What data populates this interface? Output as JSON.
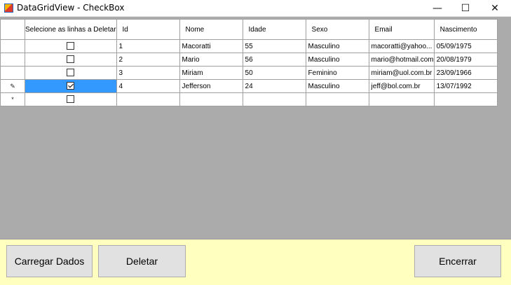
{
  "window": {
    "title": "DataGridView - CheckBox",
    "controls": {
      "minimize": "—",
      "maximize": "☐",
      "close": "✕"
    }
  },
  "grid": {
    "columns": [
      "Selecione as linhas a Deletar",
      "Id",
      "Nome",
      "Idade",
      "Sexo",
      "Email",
      "Nascimento"
    ],
    "rows": [
      {
        "checked": false,
        "id": "1",
        "nome": "Macoratti",
        "idade": "55",
        "sexo": "Masculino",
        "email": "macoratti@yahoo...",
        "nascimento": "05/09/1975",
        "indicator": ""
      },
      {
        "checked": false,
        "id": "2",
        "nome": "Mario",
        "idade": "56",
        "sexo": "Masculino",
        "email": "mario@hotmail.com",
        "nascimento": "20/08/1979",
        "indicator": ""
      },
      {
        "checked": false,
        "id": "3",
        "nome": "Miriam",
        "idade": "50",
        "sexo": "Feminino",
        "email": "miriam@uol.com.br",
        "nascimento": "23/09/1966",
        "indicator": ""
      },
      {
        "checked": true,
        "id": "4",
        "nome": "Jefferson",
        "idade": "24",
        "sexo": "Masculino",
        "email": "jeff@bol.com.br",
        "nascimento": "13/07/1992",
        "indicator": "✎"
      }
    ],
    "new_row_indicator": "*",
    "new_row_checked": false
  },
  "buttons": {
    "load": "Carregar Dados",
    "delete": "Deletar",
    "close": "Encerrar"
  },
  "colors": {
    "panel": "#ffffc0",
    "selection": "#3399ff",
    "grid_background": "#ababab"
  }
}
